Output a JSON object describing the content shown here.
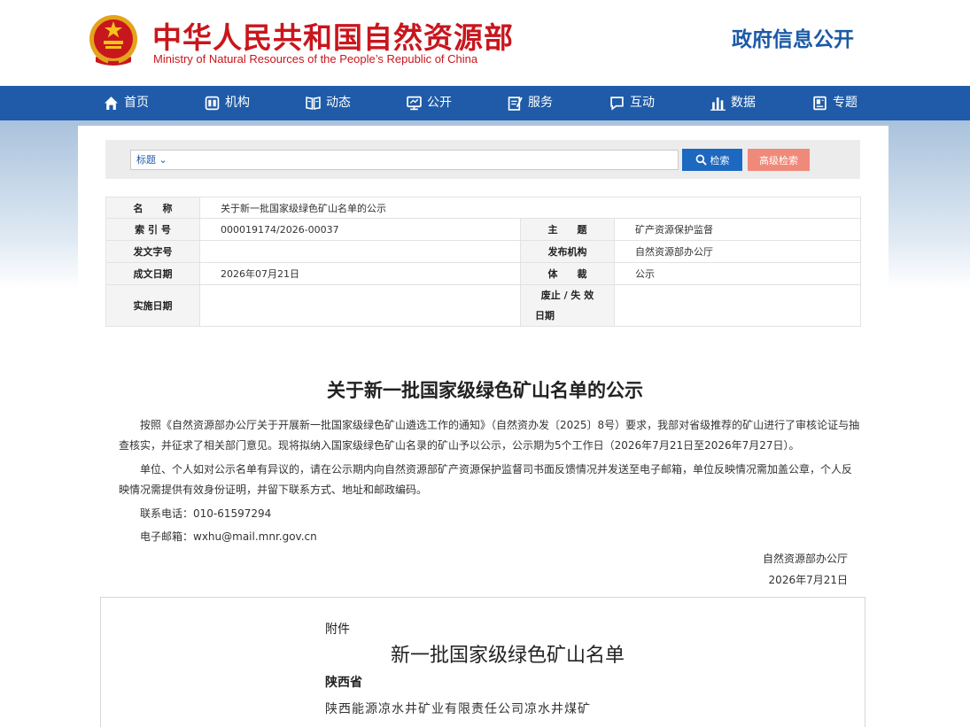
{
  "header": {
    "title_cn": "中华人民共和国自然资源部",
    "title_en": "Ministry of Natural Resources of the People’s Republic of China",
    "gov_info": "政府信息公开",
    "emblem_icon": "national-emblem-icon"
  },
  "nav": {
    "items": [
      {
        "label": "首页",
        "icon": "home-icon"
      },
      {
        "label": "机构",
        "icon": "organization-icon"
      },
      {
        "label": "动态",
        "icon": "news-icon"
      },
      {
        "label": "公开",
        "icon": "disclosure-icon"
      },
      {
        "label": "服务",
        "icon": "service-icon"
      },
      {
        "label": "互动",
        "icon": "chat-icon"
      },
      {
        "label": "数据",
        "icon": "data-chart-icon"
      },
      {
        "label": "专题",
        "icon": "topic-icon"
      }
    ]
  },
  "search": {
    "type_label": "标题",
    "value": "",
    "search_label": "检索",
    "advanced_label": "高级检索"
  },
  "meta": {
    "name_label": "名　　称",
    "name_value": "关于新一批国家级绿色矿山名单的公示",
    "index_label": "索 引 号",
    "index_value": "000019174/2026-00037",
    "subject_label": "主　　题",
    "subject_value": "矿产资源保护监督",
    "docno_label": "发文字号",
    "docno_value": "",
    "publisher_label": "发布机构",
    "publisher_value": "自然资源部办公厅",
    "date_label": "成文日期",
    "date_value": "2026年07月21日",
    "genre_label": "体　　裁",
    "genre_value": "公示",
    "effective_label": "实施日期",
    "effective_value": "",
    "expire_label_1": "废止 / 失 效",
    "expire_label_2": "日期",
    "expire_value": ""
  },
  "article": {
    "title": "关于新一批国家级绿色矿山名单的公示",
    "p1": "按照《自然资源部办公厅关于开展新一批国家级绿色矿山遴选工作的通知》（自然资办发〔2025〕8号）要求，我部对省级推荐的矿山进行了审核论证与抽查核实，并征求了相关部门意见。现将拟纳入国家级绿色矿山名录的矿山予以公示，公示期为5个工作日（2026年7月21日至2026年7月27日）。",
    "p2": "单位、个人如对公示名单有异议的，请在公示期内向自然资源部矿产资源保护监督司书面反馈情况并发送至电子邮箱，单位反映情况需加盖公章，个人反映情况需提供有效身份证明，并留下联系方式、地址和邮政编码。",
    "phone": "联系电话：010-61597294",
    "email": "电子邮箱：wxhu@mail.mnr.gov.cn",
    "sign_org": "自然资源部办公厅",
    "sign_date": "2026年7月21日"
  },
  "attachment": {
    "label": "附件",
    "title": "新一批国家级绿色矿山名单",
    "province": "陕西省",
    "mine": "陕西能源凉水井矿业有限责任公司凉水井煤矿"
  },
  "colors": {
    "brand_red": "#c8161d",
    "nav_blue": "#1f5ba8",
    "search_blue": "#1d68c0",
    "advanced_salmon": "#ef8a7b"
  }
}
